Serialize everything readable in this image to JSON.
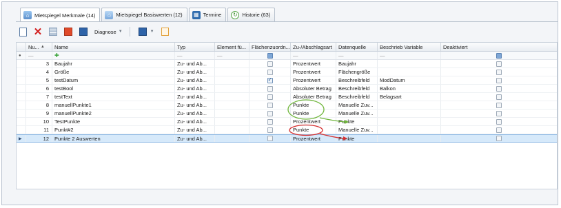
{
  "tabs": [
    {
      "label": "Mietspiegel Merkmale (14)",
      "icon": "house-icon",
      "active": true
    },
    {
      "label": "Mietspiegel Basiswerten (12)",
      "icon": "house-icon",
      "active": false
    },
    {
      "label": "Termine",
      "icon": "calendar-icon",
      "active": false
    },
    {
      "label": "Historie (63)",
      "icon": "history-icon",
      "active": false
    }
  ],
  "toolbar": {
    "diagnose_label": "Diagnose"
  },
  "columns": [
    "Nu...",
    "Name",
    "Typ",
    "Element fü...",
    "Flächenzuordn...",
    "Zu-/Abschlagsart",
    "Datenquelle",
    "Beschrieb Variable",
    "Deaktiviert"
  ],
  "filter_row": {
    "nu": "—",
    "typ": "—",
    "element": "—",
    "zu": "—",
    "daten": "—",
    "beschrieb": "—"
  },
  "rows": [
    {
      "nu": "3",
      "name": "Baujahr",
      "typ": "Zu- und Ab...",
      "element": "",
      "flaeche": false,
      "zu": "Prozentwert",
      "daten": "Baujahr",
      "beschrieb": "",
      "deakt": false
    },
    {
      "nu": "4",
      "name": "Größe",
      "typ": "Zu- und Ab...",
      "element": "",
      "flaeche": false,
      "zu": "Prozentwert",
      "daten": "Flächengröße",
      "beschrieb": "",
      "deakt": false
    },
    {
      "nu": "5",
      "name": "testDatum",
      "typ": "Zu- und Ab...",
      "element": "",
      "flaeche": true,
      "zu": "Prozentwert",
      "daten": "Beschreibfeld",
      "beschrieb": "ModDatum",
      "deakt": false
    },
    {
      "nu": "6",
      "name": "testBool",
      "typ": "Zu- und Ab...",
      "element": "",
      "flaeche": false,
      "zu": "Absoluter Betrag",
      "daten": "Beschreibfeld",
      "beschrieb": "Balkon",
      "deakt": false
    },
    {
      "nu": "7",
      "name": "testText",
      "typ": "Zu- und Ab...",
      "element": "",
      "flaeche": false,
      "zu": "Absoluter Betrag",
      "daten": "Beschreibfeld",
      "beschrieb": "Belagsart",
      "deakt": false
    },
    {
      "nu": "8",
      "name": "manuellPunkte1",
      "typ": "Zu- und Ab...",
      "element": "",
      "flaeche": false,
      "zu": "Punkte",
      "daten": "Manuelle Zuv...",
      "beschrieb": "",
      "deakt": false
    },
    {
      "nu": "9",
      "name": "manuellPunkte2",
      "typ": "Zu- und Ab...",
      "element": "",
      "flaeche": false,
      "zu": "Punkte",
      "daten": "Manuelle Zuv...",
      "beschrieb": "",
      "deakt": false
    },
    {
      "nu": "10",
      "name": "TestPunkte",
      "typ": "Zu- und Ab...",
      "element": "",
      "flaeche": false,
      "zu": "Prozentwert",
      "daten": "Punkte",
      "beschrieb": "",
      "deakt": false
    },
    {
      "nu": "11",
      "name": "Punkt#2",
      "typ": "Zu- und Ab...",
      "element": "",
      "flaeche": false,
      "zu": "Punkte",
      "daten": "Manuelle Zuv...",
      "beschrieb": "",
      "deakt": false
    },
    {
      "nu": "12",
      "name": "Punkte 2 Auswerten",
      "typ": "Zu- und Ab...",
      "element": "",
      "flaeche": false,
      "zu": "Prozentwert",
      "daten": "Punkte",
      "beschrieb": "",
      "deakt": false,
      "selected": true
    }
  ],
  "annotation_colors": {
    "green": "#6fb63b",
    "red": "#d63030"
  }
}
